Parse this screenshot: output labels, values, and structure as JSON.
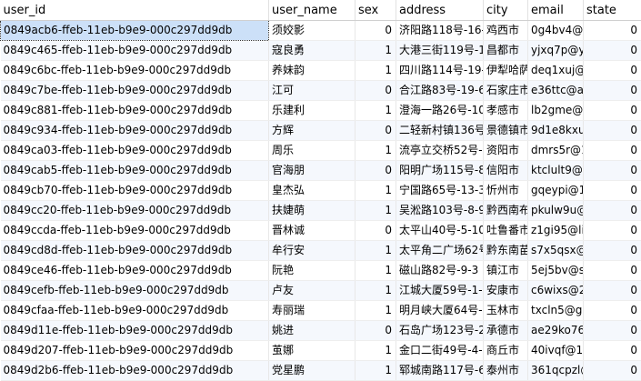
{
  "columns": [
    "user_id",
    "user_name",
    "sex",
    "address",
    "city",
    "email",
    "state"
  ],
  "rows": [
    [
      "0849acb6-ffeb-11eb-b9e9-000c297dd9db",
      "须姣影",
      "0",
      "济阳路118号-16-",
      "鸡西市",
      "0g4bv4@s",
      "0"
    ],
    [
      "0849c465-ffeb-11eb-b9e9-000c297dd9db",
      "寇良勇",
      "1",
      "大港三街119号-1",
      "昌都市",
      "yjxq7p@ya",
      "0"
    ],
    [
      "0849c6bc-ffeb-11eb-b9e9-000c297dd9db",
      "养妹韵",
      "1",
      "四川路114号-19-",
      "伊犁哈萨",
      "deq1xuj@",
      "0"
    ],
    [
      "0849c7be-ffeb-11eb-b9e9-000c297dd9db",
      "江可",
      "0",
      "合江路83号-19-6",
      "石家庄市",
      "e36ttc@ac",
      "0"
    ],
    [
      "0849c881-ffeb-11eb-b9e9-000c297dd9db",
      "乐建利",
      "1",
      "澄海一路26号-10",
      "孝感市",
      "lb2gme@s",
      "0"
    ],
    [
      "0849c934-ffeb-11eb-b9e9-000c297dd9db",
      "方辉",
      "0",
      "二轻新村镇136号",
      "景德镇市",
      "9d1e8kxu(",
      "0"
    ],
    [
      "0849ca03-ffeb-11eb-b9e9-000c297dd9db",
      "周乐",
      "1",
      "流亭立交桥52号-",
      "资阳市",
      "dmrs5r@1",
      "0"
    ],
    [
      "0849cab5-ffeb-11eb-b9e9-000c297dd9db",
      "官海朋",
      "0",
      "阳明广场115号-8",
      "信阳市",
      "ktclult9@s",
      "0"
    ],
    [
      "0849cb70-ffeb-11eb-b9e9-000c297dd9db",
      "皇杰弘",
      "1",
      "宁国路65号-13-3",
      "忻州市",
      "gqeypi@1",
      "0"
    ],
    [
      "0849cc20-ffeb-11eb-b9e9-000c297dd9db",
      "扶婕萌",
      "1",
      "吴淞路103号-8-9",
      "黔西南布",
      "pkulw9u@",
      "0"
    ],
    [
      "0849ccda-ffeb-11eb-b9e9-000c297dd9db",
      "晋林诚",
      "0",
      "太平山40号-5-10",
      "吐鲁番市",
      "z1gi95@liv",
      "0"
    ],
    [
      "0849cd8d-ffeb-11eb-b9e9-000c297dd9db",
      "牟行安",
      "1",
      "太平角二广场62号",
      "黔东南苗",
      "s7x5qsx@",
      "0"
    ],
    [
      "0849ce46-ffeb-11eb-b9e9-000c297dd9db",
      "阮艳",
      "1",
      "磁山路82号-9-3",
      "镇江市",
      "5ej5bv@s",
      "0"
    ],
    [
      "0849cefb-ffeb-11eb-b9e9-000c297dd9db",
      "卢友",
      "1",
      "江城大厦59号-1-2",
      "安康市",
      "c6wixs@26",
      "0"
    ],
    [
      "0849cfaa-ffeb-11eb-b9e9-000c297dd9db",
      "寿丽瑞",
      "1",
      "明月峡大厦64号-",
      "玉林市",
      "txcln5@gc",
      "0"
    ],
    [
      "0849d11e-ffeb-11eb-b9e9-000c297dd9db",
      "姚进",
      "0",
      "石岛广场123号-2",
      "承德市",
      "ae29ko76",
      "0"
    ],
    [
      "0849d207-ffeb-11eb-b9e9-000c297dd9db",
      "茧娜",
      "1",
      "金口二街49号-4-",
      "商丘市",
      "40ivqf@12",
      "0"
    ],
    [
      "0849d2b6-ffeb-11eb-b9e9-000c297dd9db",
      "党星鹏",
      "1",
      "郓城南路117号-6",
      "泰州市",
      "361qcpzl@",
      "0"
    ]
  ],
  "selected_cell": {
    "row": 0,
    "column": 0
  }
}
